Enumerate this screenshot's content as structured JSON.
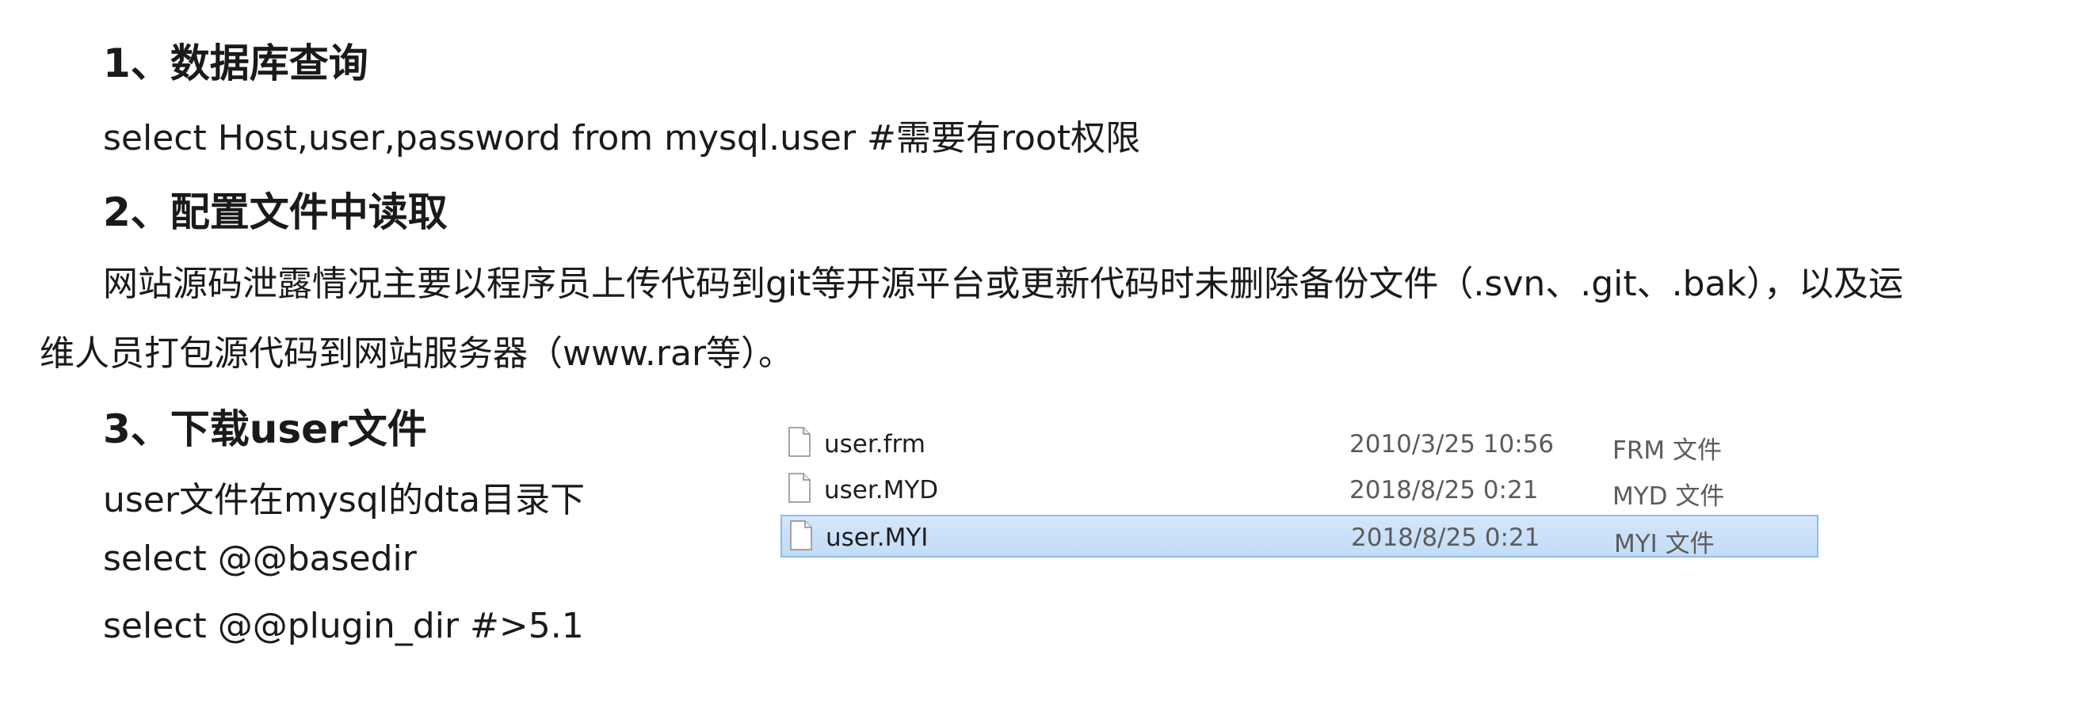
{
  "section1": {
    "heading": "1、数据库查询",
    "line": "select Host,user,password from mysql.user #需要有root权限"
  },
  "section2": {
    "heading": "2、配置文件中读取",
    "paragraph_line1": "网站源码泄露情况主要以程序员上传代码到git等开源平台或更新代码时未删除备份文件（.svn、.git、.bak），以及运",
    "paragraph_line2": "维人员打包源代码到网站服务器（www.rar等）。"
  },
  "section3": {
    "heading": "3、下载user文件",
    "lines": [
      "user文件在mysql的dta目录下",
      "select @@basedir",
      "select @@plugin_dir  #>5.1"
    ]
  },
  "files": [
    {
      "name": "user.frm",
      "date": "2010/3/25 10:56",
      "type": "FRM 文件",
      "selected": false,
      "icon": "file-icon"
    },
    {
      "name": "user.MYD",
      "date": "2018/8/25 0:21",
      "type": "MYD 文件",
      "selected": false,
      "icon": "file-icon"
    },
    {
      "name": "user.MYI",
      "date": "2018/8/25 0:21",
      "type": "MYI 文件",
      "selected": true,
      "icon": "file-icon"
    }
  ],
  "colors": {
    "selection": "#c9e0f9",
    "selection_border": "#8fbbec"
  }
}
